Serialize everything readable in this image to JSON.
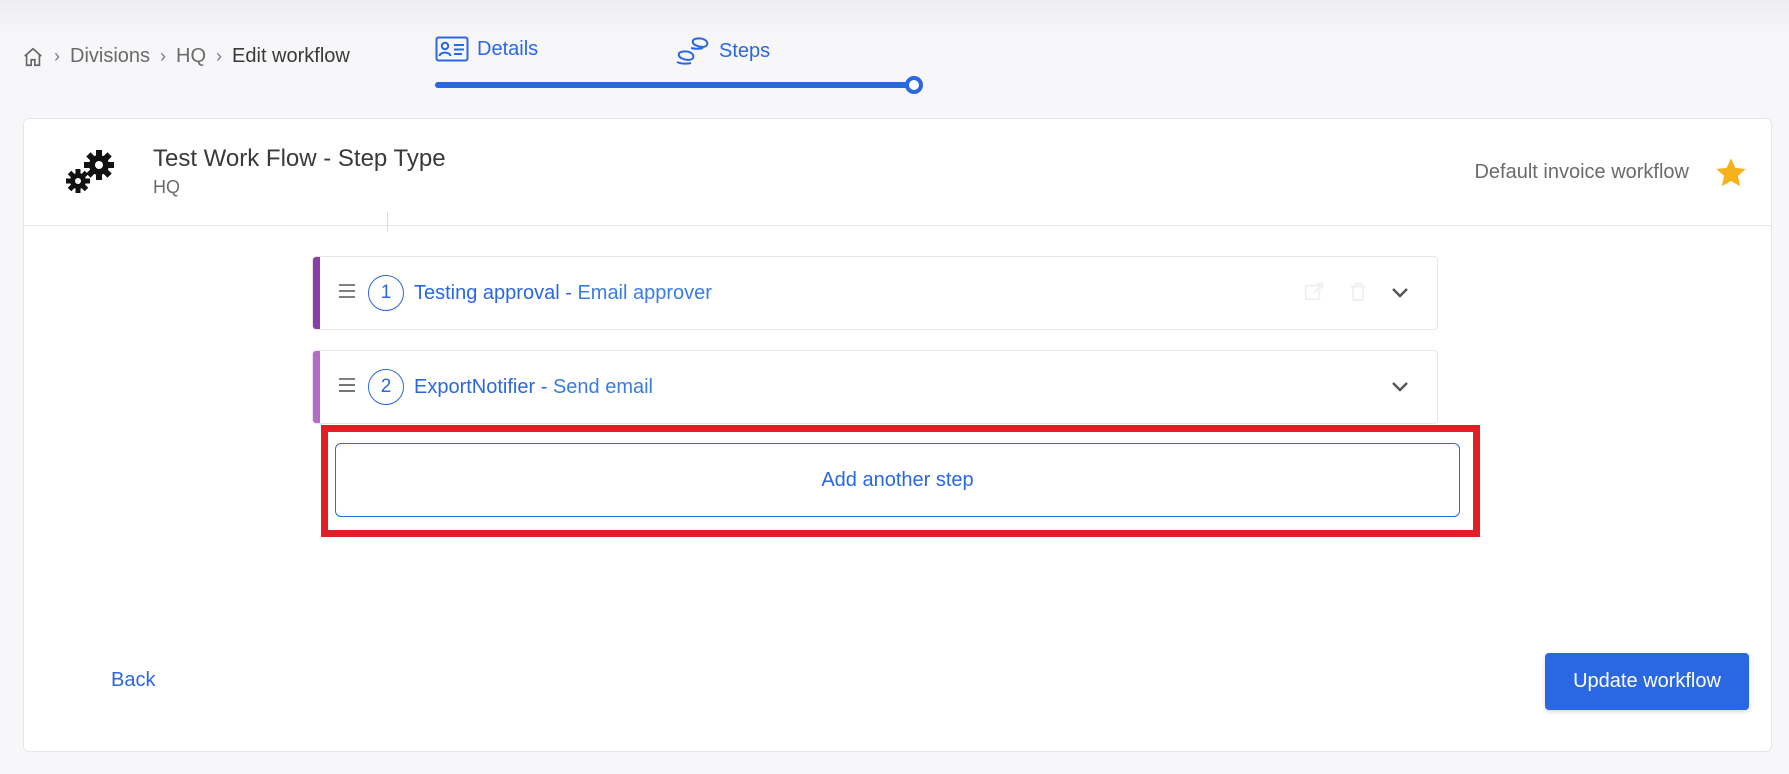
{
  "breadcrumb": {
    "items": [
      "Divisions",
      "HQ"
    ],
    "current": "Edit workflow"
  },
  "stepper": {
    "tabs": [
      {
        "label": "Details",
        "icon": "id-card-icon"
      },
      {
        "label": "Steps",
        "icon": "footsteps-icon"
      }
    ],
    "progress": 1.0
  },
  "workflow": {
    "title": "Test Work Flow - Step Type",
    "division": "HQ",
    "default_label": "Default invoice workflow",
    "icon": "gears-icon"
  },
  "steps": [
    {
      "number": "1",
      "name": "Testing approval -",
      "type": "Email approver",
      "color": "#8b3ea8"
    },
    {
      "number": "2",
      "name": "ExportNotifier -",
      "type": "Send email",
      "color": "#b86ac9"
    }
  ],
  "add_step_label": "Add another step",
  "footer": {
    "back_label": "Back",
    "update_label": "Update workflow"
  },
  "colors": {
    "accent": "#2a67e3",
    "highlight": "#e01f26",
    "star": "#f5b21b"
  }
}
